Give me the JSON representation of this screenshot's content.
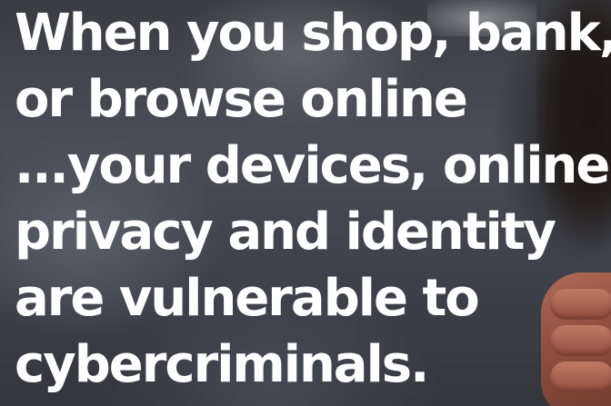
{
  "hero": {
    "headline_lines": [
      "When you shop, bank,",
      "or browse online",
      "...your devices, online",
      "privacy and identity",
      "are vulnerable to",
      "cybercriminals."
    ]
  }
}
